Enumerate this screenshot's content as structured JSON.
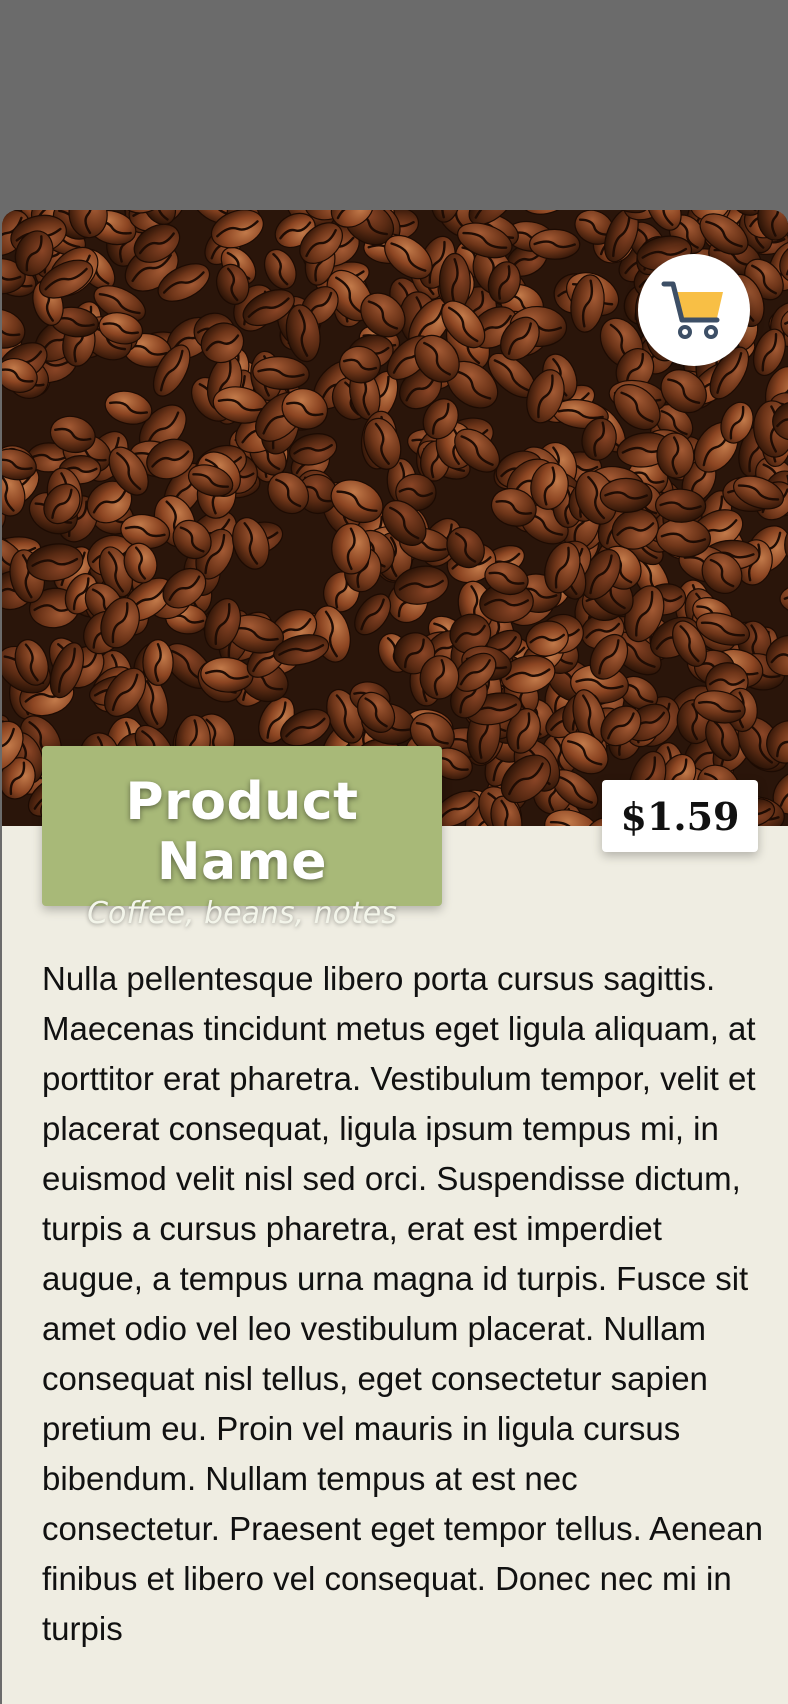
{
  "product": {
    "name": "Product Name",
    "subtitle": "Coffee, beans, notes",
    "price": "$1.59",
    "description": "Nulla pellentesque libero porta cursus sagittis. Maecenas tincidunt metus eget ligula aliquam, at porttitor erat pharetra. Vestibulum tempor, velit et placerat consequat, ligula ipsum tempus mi, in euismod velit nisl sed orci. Suspendisse dictum, turpis a cursus pharetra, erat est imperdiet augue, a tempus urna magna id turpis. Fusce sit amet odio vel leo vestibulum placerat. Nullam consequat nisl tellus, eget consectetur sapien pretium eu. Proin vel mauris in ligula cursus bibendum. Nullam tempus at est nec consectetur. Praesent eget tempor tellus. Aenean finibus et libero vel consequat. Donec nec mi in turpis"
  },
  "icons": {
    "cart": "shopping-cart-icon"
  },
  "colors": {
    "backdrop": "#6b6b6b",
    "sheet": "#efede2",
    "title_card": "#a8b978",
    "cart_fill": "#f8bf45",
    "cart_outline": "#3d4f66"
  }
}
